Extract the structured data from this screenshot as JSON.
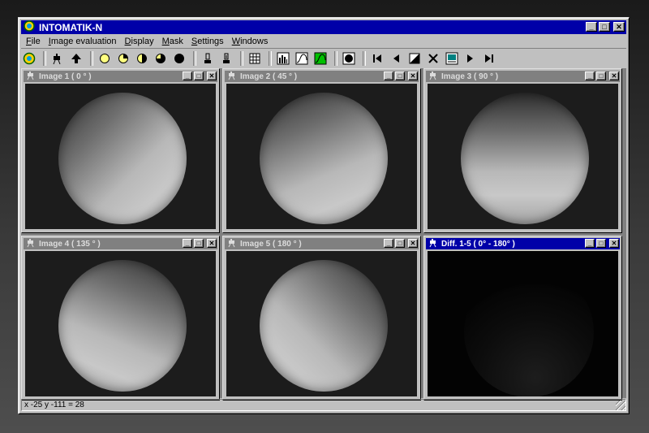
{
  "app": {
    "title": "INTOMATIK-N",
    "window_buttons": {
      "minimize": "_",
      "maximize": "□",
      "close": "✕"
    }
  },
  "menu": [
    {
      "label": "File",
      "access": "F",
      "rest": "ile"
    },
    {
      "label": "Image evaluation",
      "access": "I",
      "rest": "mage evaluation"
    },
    {
      "label": "Display",
      "access": "D",
      "rest": "isplay"
    },
    {
      "label": "Mask",
      "access": "M",
      "rest": "ask"
    },
    {
      "label": "Settings",
      "access": "S",
      "rest": "ettings"
    },
    {
      "label": "Windows",
      "access": "W",
      "rest": "indows"
    }
  ],
  "toolbar": {
    "icons": [
      "app-icon",
      "camera-icon",
      "arrow-up-icon",
      "circle-empty-icon",
      "circle-quarter-icon",
      "circle-half-icon",
      "circle-three-quarter-icon",
      "circle-full-icon",
      "lamp-icon",
      "lamp-alt-icon",
      "grid-icon",
      "histogram-icon",
      "curve-icon",
      "curve-green-icon",
      "mask-icon",
      "first-icon",
      "prev-icon",
      "contrast-icon",
      "close-x-icon",
      "view-icon",
      "next-icon",
      "last-icon"
    ],
    "glyphs": {
      "first": "⏮",
      "prev": "◀",
      "x": "✕",
      "next": "▶",
      "last": "⏭",
      "up": "🡅"
    }
  },
  "children": [
    {
      "title": "Image 1 ( 0 ° )",
      "active": false,
      "kind": "image",
      "light_angle": 0
    },
    {
      "title": "Image 2 ( 45 ° )",
      "active": false,
      "kind": "image",
      "light_angle": 45
    },
    {
      "title": "Image 3 ( 90 ° )",
      "active": false,
      "kind": "image",
      "light_angle": 90
    },
    {
      "title": "Image 4 ( 135 ° )",
      "active": false,
      "kind": "image",
      "light_angle": 135
    },
    {
      "title": "Image 5 ( 180 ° )",
      "active": false,
      "kind": "image",
      "light_angle": 180
    },
    {
      "title": "Diff. 1-5 ( 0° - 180° )",
      "active": true,
      "kind": "diff",
      "light_angle": 0
    }
  ],
  "status": {
    "text": "x -25 y -111 = 28"
  },
  "colors": {
    "title_active": "#0000a8",
    "title_inactive": "#808080",
    "face": "#c0c0c0"
  }
}
